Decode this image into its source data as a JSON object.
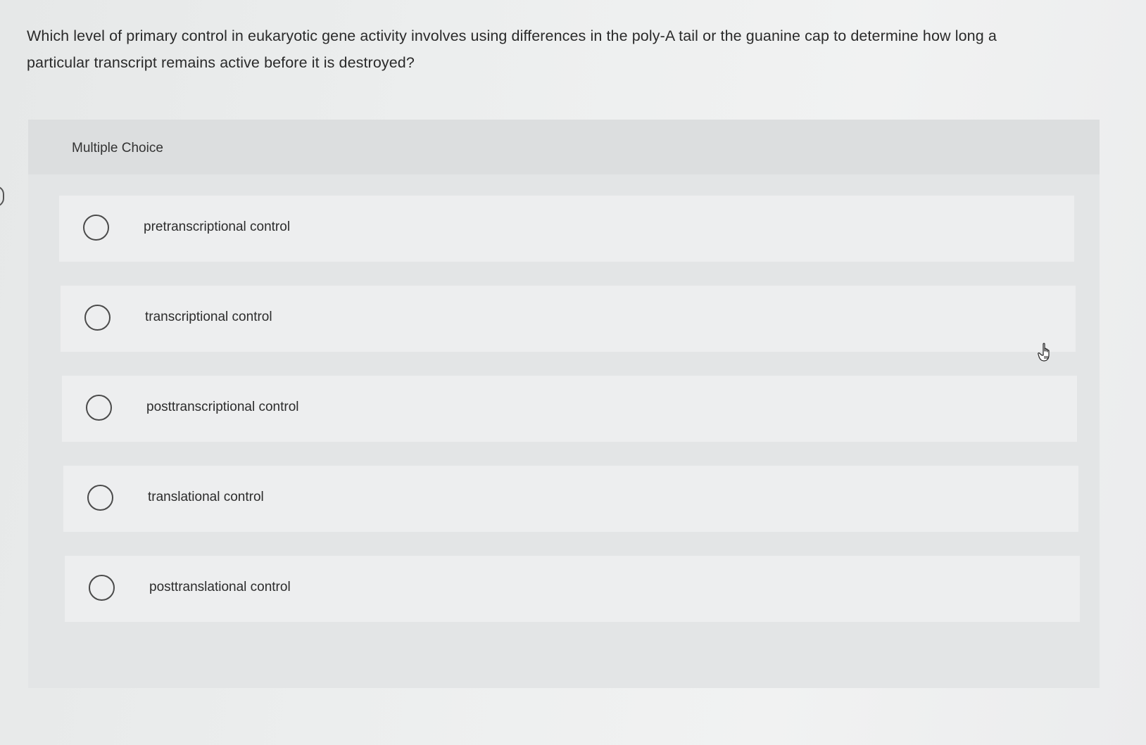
{
  "question": {
    "text": "Which level of primary control in eukaryotic gene activity involves using differences in the poly-A tail or the guanine cap to determine how long a particular transcript remains active before it is destroyed?"
  },
  "panel": {
    "header_label": "Multiple Choice"
  },
  "options": [
    {
      "label": "pretranscriptional control",
      "selected": false
    },
    {
      "label": "transcriptional control",
      "selected": false
    },
    {
      "label": "posttranscriptional control",
      "selected": false
    },
    {
      "label": "translational control",
      "selected": false
    },
    {
      "label": "posttranslational control",
      "selected": false
    }
  ],
  "cursor": {
    "icon": "hand-pointer-icon"
  }
}
